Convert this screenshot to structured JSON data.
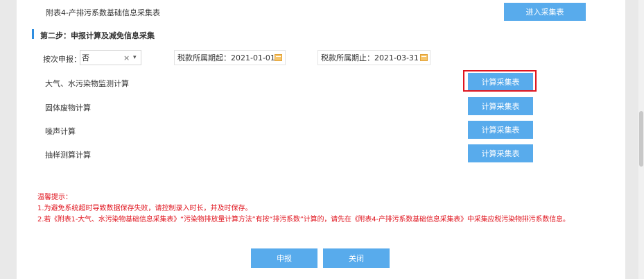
{
  "attachment4": {
    "label": "附表4-产排污系数基础信息采集表",
    "button": "进入采集表"
  },
  "step2": {
    "title": "第二步：申报计算及减免信息采集"
  },
  "filters": {
    "per_time_label": "按次申报：",
    "per_time_value": "否",
    "clear_glyph": "×",
    "dropdown_glyph": "▾",
    "period_start_label": "税款所属期起：",
    "period_start_value": "2021-01-01",
    "period_end_label": "税款所属期止：",
    "period_end_value": "2021-03-31"
  },
  "calc_rows": [
    {
      "label": "大气、水污染物监测计算",
      "button": "计算采集表"
    },
    {
      "label": "固体废物计算",
      "button": "计算采集表"
    },
    {
      "label": "噪声计算",
      "button": "计算采集表"
    },
    {
      "label": "抽样测算计算",
      "button": "计算采集表"
    }
  ],
  "tips": {
    "title": "温馨提示：",
    "line1": "1.为避免系统超时导致数据保存失败，请控制录入时长，并及时保存。",
    "line2": "2.若《附表1-大气、水污染物基础信息采集表》“污染物排放量计算方法”有按“排污系数”计算的，请先在《附表4-产排污系数基础信息采集表》中采集应税污染物排污系数信息。"
  },
  "footer": {
    "submit": "申报",
    "close": "关闭"
  },
  "colors": {
    "button_blue": "#58abec",
    "highlight_red": "#e0141e",
    "warning_red": "#e0141e",
    "section_bar": "#2f8ee0"
  },
  "icons": {
    "calendar": "calendar-icon",
    "clear": "clear-icon",
    "dropdown": "dropdown-arrow-icon"
  }
}
